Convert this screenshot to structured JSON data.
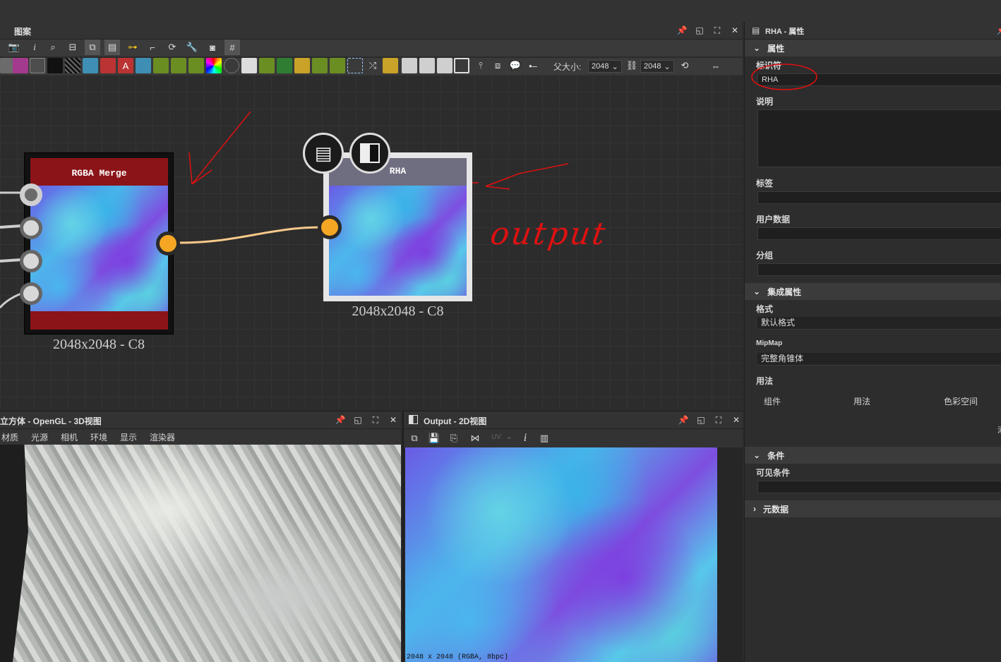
{
  "graph_panel": {
    "title": "图案",
    "parent_size_label": "父大小:",
    "width_value": "2048",
    "height_value": "2048"
  },
  "nodes": {
    "rgba_merge": {
      "title": "RGBA Merge",
      "caption": "2048x2048 - C8"
    },
    "rha": {
      "title": "RHA",
      "caption": "2048x2048 - C8"
    }
  },
  "annotation": {
    "text": "output"
  },
  "viewport3d": {
    "title": "立方体 - OpenGL - 3D视图",
    "menu": [
      "材质",
      "光源",
      "相机",
      "环境",
      "显示",
      "渲染器"
    ]
  },
  "viewport2d": {
    "title": "Output - 2D视图",
    "uv_label": "UV",
    "status": "2048 x 2048 (RGBA, 8bpc)"
  },
  "properties": {
    "title": "RHA - 属性",
    "section_attributes": "属性",
    "identifier_label": "标识符",
    "identifier_value": "RHA",
    "description_label": "说明",
    "tags_label": "标签",
    "userdata_label": "用户数据",
    "group_label": "分组",
    "section_integration": "集成属性",
    "format_label": "格式",
    "format_value": "默认格式",
    "mipmap_label": "MipMap",
    "mipmap_value": "完整角锥体",
    "usage_label": "用法",
    "usage_cols": [
      "组件",
      "用法",
      "色彩空间"
    ],
    "usage_more": "添",
    "section_conditions": "条件",
    "visible_cond_label": "可见条件",
    "section_metadata": "元数据"
  },
  "colors": {
    "accent_orange": "#f5a623",
    "node_red": "#8b1418",
    "annotation_red": "#d11"
  }
}
